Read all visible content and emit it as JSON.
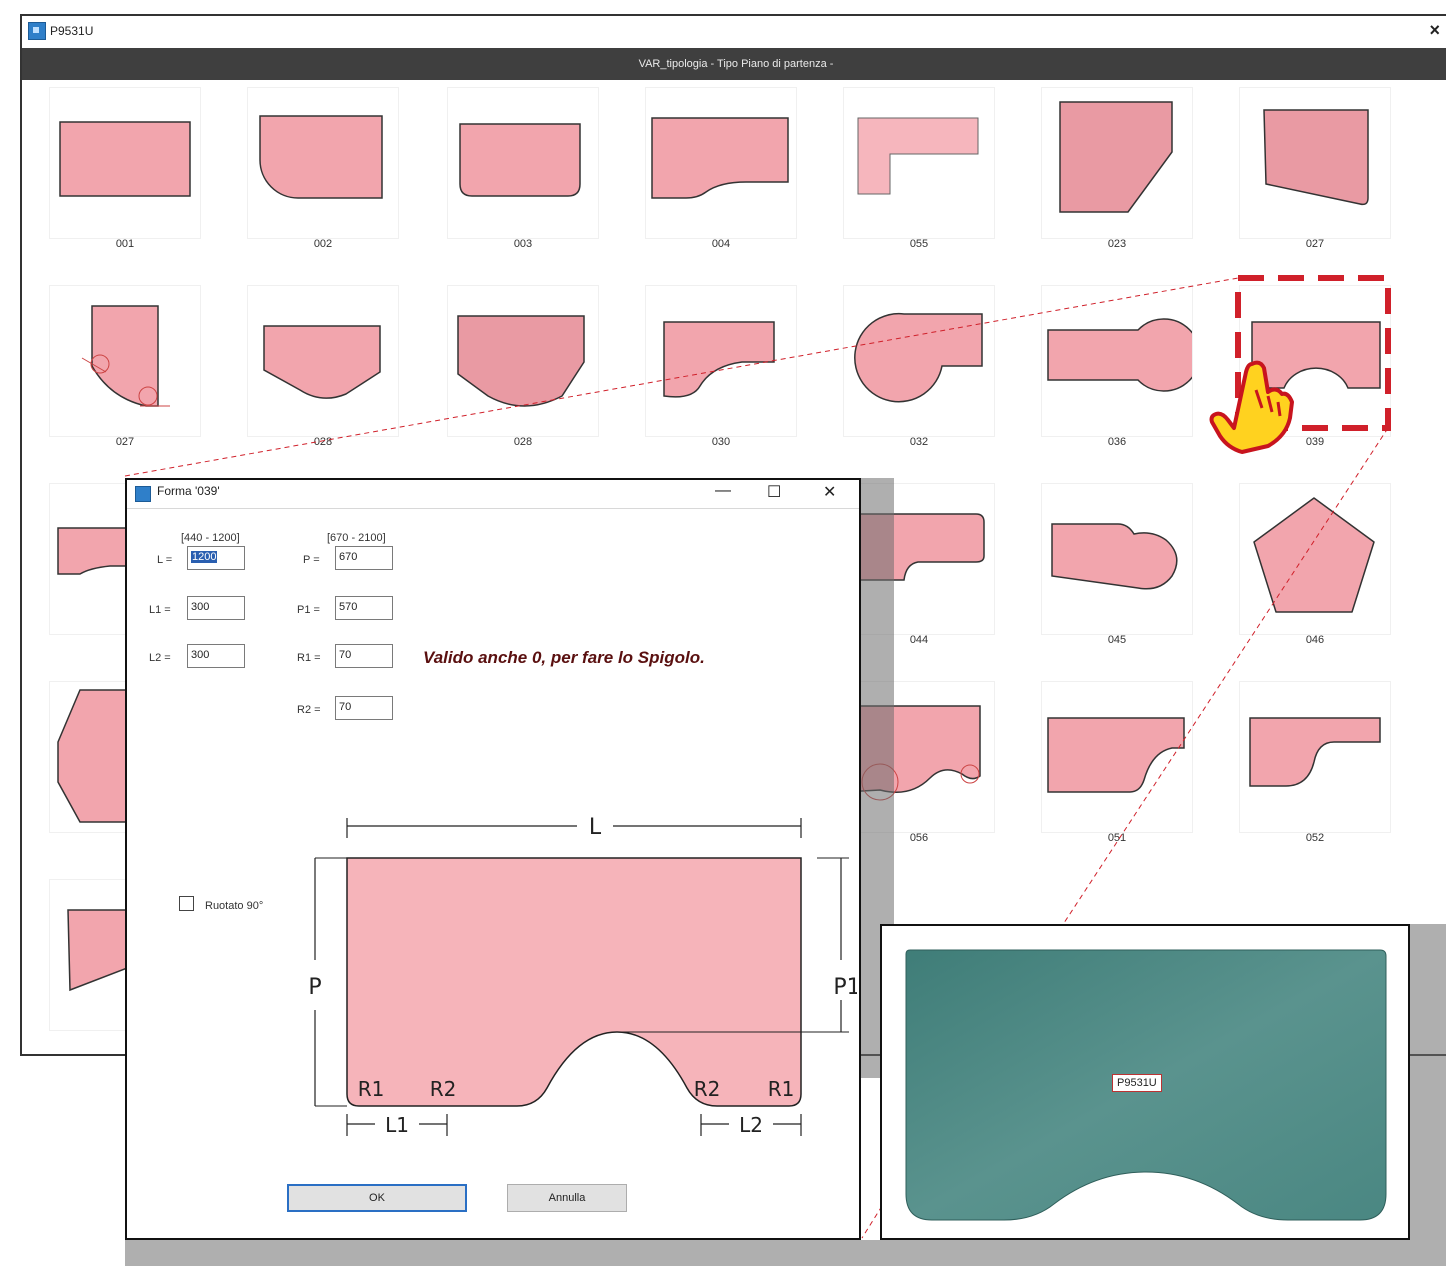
{
  "window": {
    "title": "P9531U",
    "header": "VAR_tipologia - Tipo Piano di partenza -"
  },
  "tiles": [
    "001",
    "002",
    "003",
    "004",
    "055",
    "023",
    "027",
    "027",
    "028",
    "028",
    "030",
    "032",
    "036",
    "039",
    "044",
    "045",
    "046",
    "056",
    "051",
    "052"
  ],
  "dialog": {
    "title": "Forma '039'",
    "minimize": "—",
    "maximize": "☐",
    "close": "✕",
    "ranges": {
      "l": "[440 - 1200]",
      "p": "[670 - 2100]"
    },
    "fields": {
      "L": {
        "label": "L =",
        "value": "1200"
      },
      "L1": {
        "label": "L1 =",
        "value": "300"
      },
      "L2": {
        "label": "L2 =",
        "value": "300"
      },
      "P": {
        "label": "P =",
        "value": "670"
      },
      "P1": {
        "label": "P1 =",
        "value": "570"
      },
      "R1": {
        "label": "R1 =",
        "value": "70"
      },
      "R2": {
        "label": "R2 =",
        "value": "70"
      }
    },
    "note": "Valido anche 0, per fare lo Spigolo.",
    "rotate_label": "Ruotato 90°",
    "diagram_labels": {
      "L": "L",
      "P": "P",
      "P1": "P1",
      "R1": "R1",
      "R2": "R2",
      "L1": "L1",
      "L2": "L2"
    },
    "ok": "OK",
    "cancel": "Annulla"
  },
  "preview": {
    "label": "P9531U"
  },
  "colors": {
    "shape_fill": "#f2a5ad",
    "shape_stroke": "#333333",
    "preview_fill": "#4e8a85",
    "highlight": "#d0202a"
  }
}
